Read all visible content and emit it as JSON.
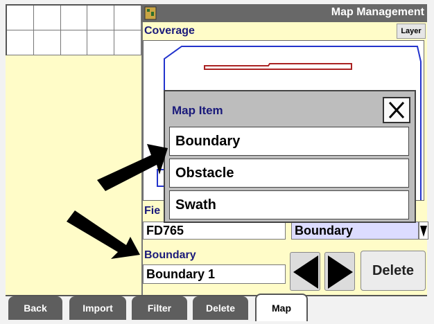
{
  "window": {
    "title": "Map Management"
  },
  "coverage": {
    "label": "Coverage"
  },
  "layer_button": {
    "label": "Layer"
  },
  "field": {
    "label_partial": "Fie",
    "value": "FD765",
    "select_value": "Boundary"
  },
  "boundary": {
    "label": "Boundary",
    "value": "Boundary 1"
  },
  "delete_button": {
    "label": "Delete"
  },
  "popup": {
    "title": "Map Item",
    "items": [
      {
        "label": "Boundary"
      },
      {
        "label": "Obstacle"
      },
      {
        "label": "Swath"
      }
    ]
  },
  "tabs": [
    {
      "label": "Back"
    },
    {
      "label": "Import"
    },
    {
      "label": "Filter"
    },
    {
      "label": "Delete"
    },
    {
      "label": "Map",
      "active": true
    }
  ],
  "colors": {
    "title_bar": "#686868",
    "panel_bg": "#fffcc8",
    "label_text": "#1a1a7a",
    "boundary_line": "#2233cc",
    "obstacle_line": "#aa2222"
  },
  "icons": [
    "app-icon",
    "close-icon",
    "arrow-left-icon",
    "arrow-right-icon",
    "dropdown-arrow-icon",
    "pointer-arrow-icon"
  ]
}
